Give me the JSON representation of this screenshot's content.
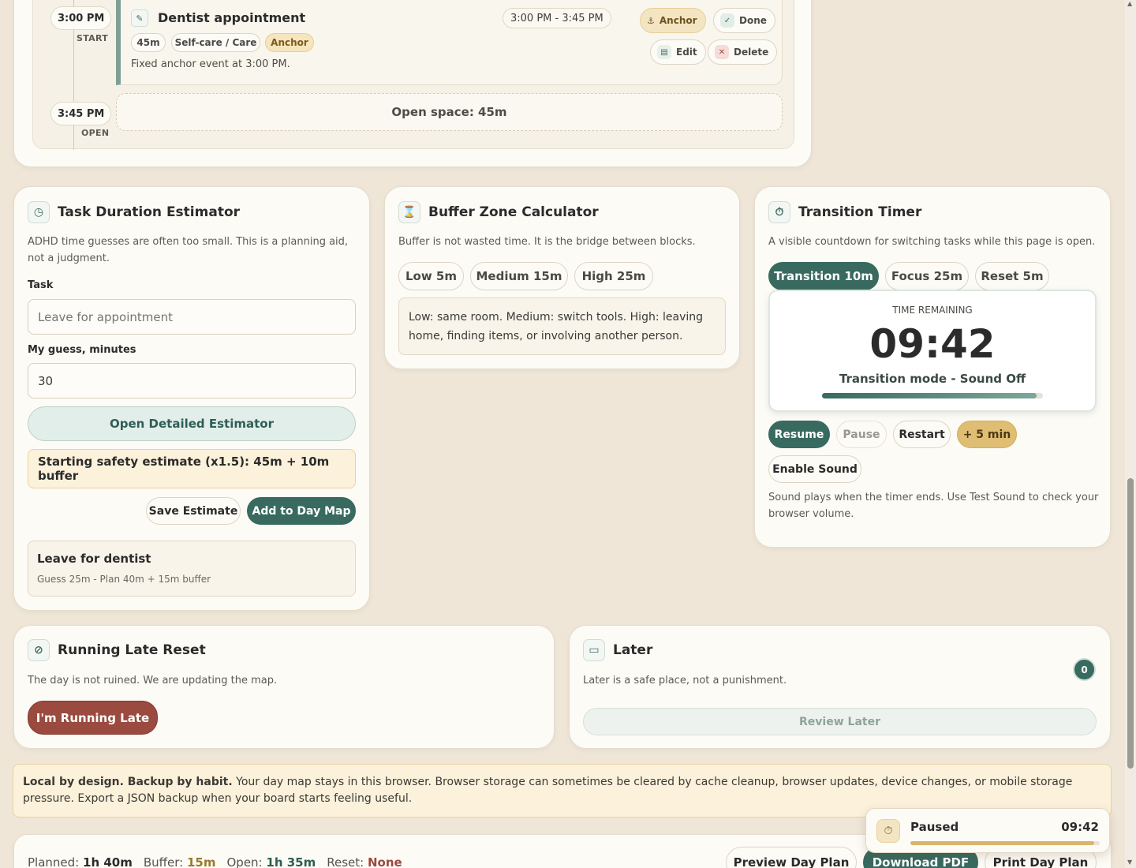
{
  "timeline": {
    "items": [
      {
        "time": "3:00 PM",
        "tag": "START",
        "title": "Dentist appointment",
        "range": "3:00 PM - 3:45 PM",
        "chips": [
          "45m",
          "Self-care / Care",
          "Anchor"
        ],
        "note": "Fixed anchor event at 3:00 PM.",
        "actions": {
          "anchor": "Anchor",
          "done": "Done",
          "edit": "Edit",
          "delete": "Delete"
        }
      },
      {
        "time": "3:45 PM",
        "tag": "OPEN",
        "open_text": "Open space: 45m"
      }
    ]
  },
  "estimator": {
    "title": "Task Duration Estimator",
    "description": "ADHD time guesses are often too small. This is a planning aid, not a judgment.",
    "task_label": "Task",
    "task_placeholder": "Leave for appointment",
    "guess_label": "My guess, minutes",
    "guess_value": "30",
    "detailed_button": "Open Detailed Estimator",
    "safety_text": "Starting safety estimate (x1.5): 45m + 10m buffer",
    "save_button": "Save Estimate",
    "add_button": "Add to Day Map",
    "saved": {
      "title": "Leave for dentist",
      "detail": "Guess 25m - Plan 40m + 15m buffer"
    }
  },
  "buffer": {
    "title": "Buffer Zone Calculator",
    "description": "Buffer is not wasted time. It is the bridge between blocks.",
    "options": [
      "Low 5m",
      "Medium 15m",
      "High 25m"
    ],
    "info": "Low: same room. Medium: switch tools. High: leaving home, finding items, or involving another person."
  },
  "timer": {
    "title": "Transition Timer",
    "description": "A visible countdown for switching tasks while this page is open.",
    "modes": [
      "Transition 10m",
      "Focus 25m",
      "Reset 5m"
    ],
    "remaining_label": "TIME REMAINING",
    "time": "09:42",
    "status": "Transition mode - Sound Off",
    "progress": 0.97,
    "controls": {
      "resume": "Resume",
      "pause": "Pause",
      "restart": "Restart",
      "plus5": "+ 5 min"
    },
    "sound_button": "Enable Sound",
    "sound_note": "Sound plays when the timer ends. Use Test Sound to check your browser volume."
  },
  "late": {
    "title": "Running Late Reset",
    "description": "The day is not ruined. We are updating the map.",
    "button": "I'm Running Late"
  },
  "later": {
    "title": "Later",
    "description": "Later is a safe place, not a punishment.",
    "count": "0",
    "button": "Review Later"
  },
  "notice": {
    "bold": "Local by design. Backup by habit.",
    "text": " Your day map stays in this browser. Browser storage can sometimes be cleared by cache cleanup, browser updates, device changes, or mobile storage pressure. Export a JSON backup when your board starts feeling useful."
  },
  "footer": {
    "planned_label": "Planned:",
    "planned_value": "1h 40m",
    "buffer_label": "Buffer:",
    "buffer_value": "15m",
    "open_label": "Open:",
    "open_value": "1h 35m",
    "reset_label": "Reset:",
    "reset_value": "None",
    "preview_button": "Preview Day Plan",
    "pdf_button": "Download PDF",
    "print_button": "Print Day Plan"
  },
  "mini_timer": {
    "status": "Paused",
    "time": "09:42",
    "progress": 0.97
  },
  "colors": {
    "primary": "#386a5f",
    "danger": "#9b4a3f",
    "accent": "#d8b66c",
    "background": "#efe6d8"
  }
}
